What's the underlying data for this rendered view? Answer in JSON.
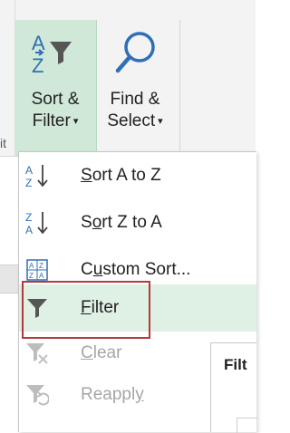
{
  "ribbon": {
    "sort_filter": {
      "line1": "Sort &",
      "line2": "Filter",
      "caret": "▾",
      "icon": "sort-filter-icon"
    },
    "find_select": {
      "line1": "Find &",
      "line2": "Select",
      "caret": "▾",
      "icon": "magnifier-icon"
    },
    "truncated_text": "it"
  },
  "menu": {
    "items": [
      {
        "label": "Sort A to Z",
        "underline_index": 0,
        "icon": "sort-a-to-z-icon",
        "disabled": false
      },
      {
        "label": "Sort Z to A",
        "underline_index": 1,
        "icon": "sort-z-to-a-icon",
        "disabled": false
      },
      {
        "label": "Custom Sort...",
        "underline_index": 1,
        "icon": "custom-sort-icon",
        "disabled": false
      },
      {
        "label": "Filter",
        "underline_index": 0,
        "icon": "filter-icon",
        "disabled": false,
        "highlighted": true
      },
      {
        "label": "Clear",
        "underline_index": 0,
        "icon": "clear-filter-icon",
        "disabled": true
      },
      {
        "label": "Reapply",
        "underline_index": 6,
        "icon": "reapply-icon",
        "disabled": true
      }
    ]
  },
  "panel": {
    "title": "Filt"
  },
  "colors": {
    "accent_green": "#cfe8d7",
    "hover_green": "#dff0e4",
    "focus_red": "#b23a3a",
    "icon_blue": "#2e6fb5",
    "icon_green": "#2f8a4a"
  }
}
